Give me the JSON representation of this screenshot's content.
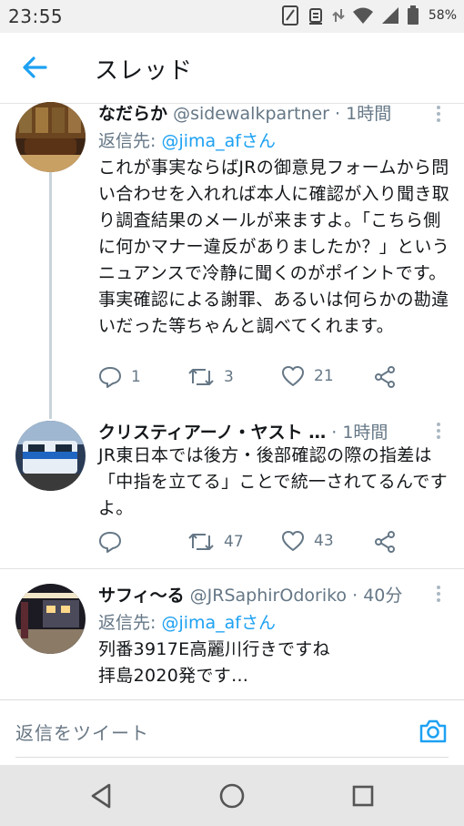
{
  "status_bar": {
    "time": "23:55",
    "battery": "58%",
    "icons": [
      "sim-icon",
      "alarm-icon",
      "data-arrows-icon",
      "wifi-icon",
      "signal-icon",
      "battery-icon"
    ]
  },
  "header": {
    "title": "スレッド",
    "back_icon": "arrow-left-icon",
    "accent": "#1da1f2"
  },
  "tweets": [
    {
      "name": "なだらか",
      "handle": "@sidewalkpartner",
      "dot": "·",
      "time": "1時間",
      "reply_prefix": "返信先: ",
      "reply_to": "@jima_afさん",
      "body": "これが事実ならばJRの御意見フォームから問い合わせを入れれば本人に確認が入り聞き取り調査結果のメールが来ますよ。「こちら側に何かマナー違反がありましたか？」というニュアンスで冷静に聞くのがポイントです。事実確認による謝罪、あるいは何らかの勘違いだった等ちゃんと調べてくれます。",
      "replies": "1",
      "retweets": "3",
      "likes": "21"
    },
    {
      "name": "クリスティアーノ・ヤスト …",
      "handle": "",
      "dot": "·",
      "time": "1時間",
      "body": "JR東日本では後方・後部確認の際の指差は「中指を立てる」ことで統一されてるんですよ。",
      "replies": "",
      "retweets": "47",
      "likes": "43"
    },
    {
      "name": "サフィ〜る",
      "handle": "@JRSaphirOdoriko",
      "dot": "·",
      "time": "40分",
      "reply_prefix": "返信先: ",
      "reply_to": "@jima_afさん",
      "body": "列番3917E高麗川行きですね\n拝島2020発です…"
    }
  ],
  "reply_bar": {
    "placeholder": "返信をツイート",
    "camera_icon": "camera-icon"
  },
  "nav": [
    "back-triangle-icon",
    "home-circle-icon",
    "recents-square-icon"
  ]
}
